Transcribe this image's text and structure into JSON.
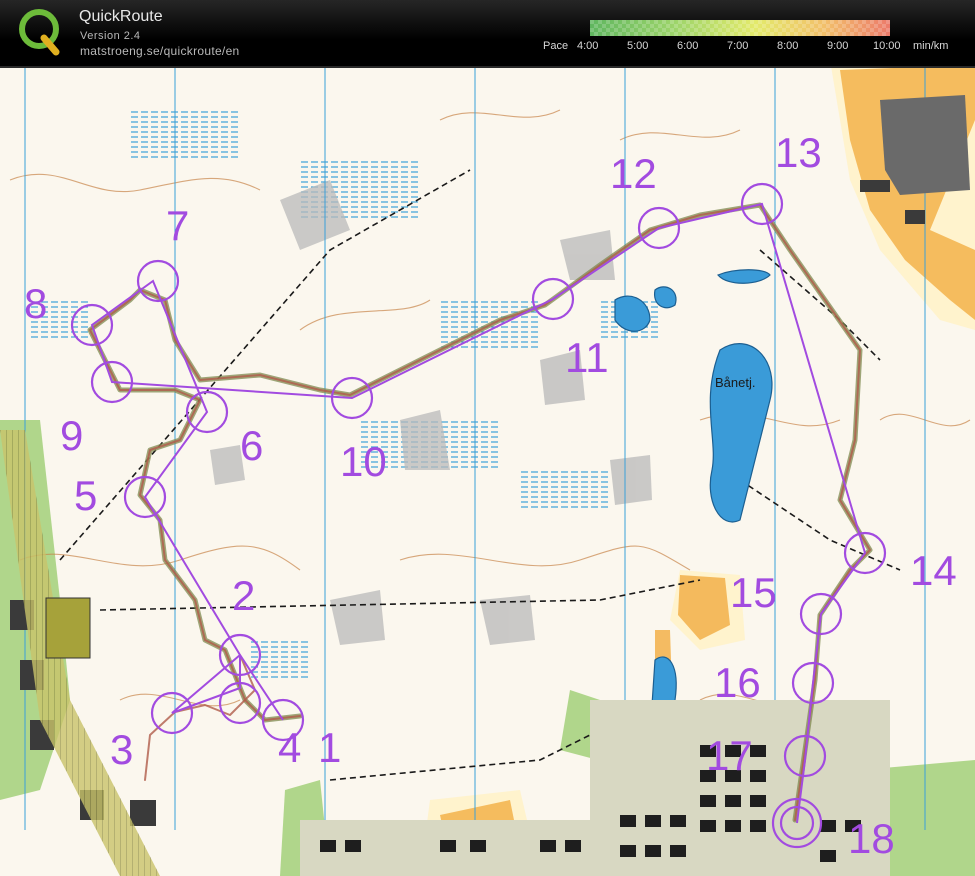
{
  "app": {
    "title": "QuickRoute",
    "version": "Version 2.4",
    "url": "matstroeng.se/quickroute/en",
    "logo_letter": "Q"
  },
  "pace_scale": {
    "label": "Pace",
    "ticks": [
      "4:00",
      "5:00",
      "6:00",
      "7:00",
      "8:00",
      "9:00",
      "10:00"
    ],
    "unit": "min/km",
    "gradient_colors": [
      "#5fb65f",
      "#9cd46a",
      "#e3ea6b",
      "#f2c06a",
      "#ec7a6a"
    ]
  },
  "map": {
    "lake_name": "Bånetj.",
    "course_color": "#a24be0",
    "route_colors": [
      "#7f8a4f",
      "#b05b4a"
    ],
    "controls": [
      {
        "number": "1"
      },
      {
        "number": "2"
      },
      {
        "number": "3"
      },
      {
        "number": "4"
      },
      {
        "number": "5"
      },
      {
        "number": "6"
      },
      {
        "number": "7"
      },
      {
        "number": "8"
      },
      {
        "number": "9"
      },
      {
        "number": "10"
      },
      {
        "number": "11"
      },
      {
        "number": "12"
      },
      {
        "number": "13"
      },
      {
        "number": "14"
      },
      {
        "number": "15"
      },
      {
        "number": "16"
      },
      {
        "number": "17"
      },
      {
        "number": "18"
      }
    ]
  }
}
